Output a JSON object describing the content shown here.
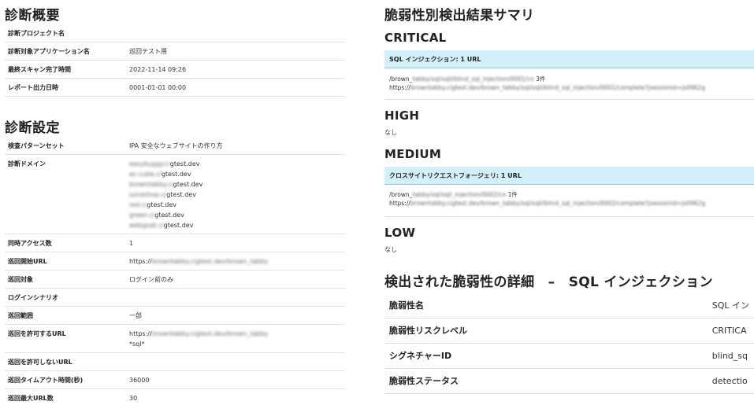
{
  "overview": {
    "title": "診断概要",
    "rows": [
      {
        "key": "診断プロジェクト名",
        "values": [
          ""
        ]
      },
      {
        "key": "診断対象アプリケーション名",
        "values": [
          "巡回テスト用"
        ]
      },
      {
        "key": "最終スキャン完了時間",
        "values": [
          "2022-11-14 09:26"
        ]
      },
      {
        "key": "レポート出力日時",
        "values": [
          "0001-01-01 00:00"
        ]
      }
    ]
  },
  "settings": {
    "title": "診断設定",
    "rows": [
      {
        "key": "検査パターンセット",
        "values": [
          "IPA 安全なウェブサイトの作り方"
        ]
      },
      {
        "key": "診断ドメイン",
        "domains": [
          {
            "blurred": "easybuggy.ci",
            "clear": "gtest.dev"
          },
          {
            "blurred": "ec-cube.ci",
            "clear": "gtest.dev"
          },
          {
            "blurred": "browntabby.ci",
            "clear": "gtest.dev"
          },
          {
            "blurred": "juiceshop.ci",
            "clear": "gtest.dev"
          },
          {
            "blurred": "red.ci",
            "clear": "gtest.dev"
          },
          {
            "blurred": "green.ci",
            "clear": "gtest.dev"
          },
          {
            "blurred": "webgoat.ci",
            "clear": "gtest.dev"
          }
        ]
      },
      {
        "key": "同時アクセス数",
        "values": [
          "1"
        ]
      },
      {
        "key": "巡回開始URL",
        "url": {
          "clear": "https://",
          "blurred": "browntabby.cigtest.dev/brown_tabby"
        }
      },
      {
        "key": "巡回対象",
        "values": [
          "ログイン前のみ"
        ]
      },
      {
        "key": "ログインシナリオ",
        "values": [
          ""
        ]
      },
      {
        "key": "巡回範囲",
        "values": [
          "一部"
        ]
      },
      {
        "key": "巡回を許可するURL",
        "url": {
          "clear": "https://",
          "blurred": "browntabby.cigtest.dev/brown_tabby"
        },
        "extra": "*sql*"
      },
      {
        "key": "巡回を許可しないURL",
        "values": [
          ""
        ]
      },
      {
        "key": "巡回タイムアウト時間(秒)",
        "values": [
          "36000"
        ]
      },
      {
        "key": "巡回最大URL数",
        "values": [
          "30"
        ]
      }
    ]
  },
  "summary": {
    "title": "脆弱性別検出結果サマリ",
    "critical": {
      "label": "CRITICAL",
      "header": "SQL インジェクション: 1 URL",
      "line1_clear": "/brown_",
      "line1_blurred": "tabby/sql/sqli/blind_sql_injection/0001/co",
      "line1_count": "3件",
      "line2_clear": "https://",
      "line2_blurred": "browntabby.cigtest.dev/brown_tabby/sql/sqli/blind_sql_injection/0001/complete?jsessionid=js0962g"
    },
    "high": {
      "label": "HIGH",
      "none": "なし"
    },
    "medium": {
      "label": "MEDIUM",
      "header": "クロスサイトリクエストフォージェリ: 1 URL",
      "line1_clear": "/brown_",
      "line1_blurred": "tabby/sql/sqli_injection/0002/co",
      "line1_count": "1件",
      "line2_clear": "https://",
      "line2_blurred": "browntabby.cigtest.dev/brown_tabby/sql/sqli/blind_sql_injection/0002/complete?jsessionid=js0962g"
    },
    "low": {
      "label": "LOW",
      "none": "なし"
    }
  },
  "detail": {
    "title": "検出された脆弱性の詳細　–　SQL インジェクション",
    "rows": [
      {
        "key": "脆弱性名",
        "value": "SQL イン"
      },
      {
        "key": "脆弱性リスクレベル",
        "value": "CRITICA"
      },
      {
        "key": "シグネチャーID",
        "value": "blind_sq"
      },
      {
        "key": "脆弱性ステータス",
        "value": "detectio"
      }
    ]
  }
}
